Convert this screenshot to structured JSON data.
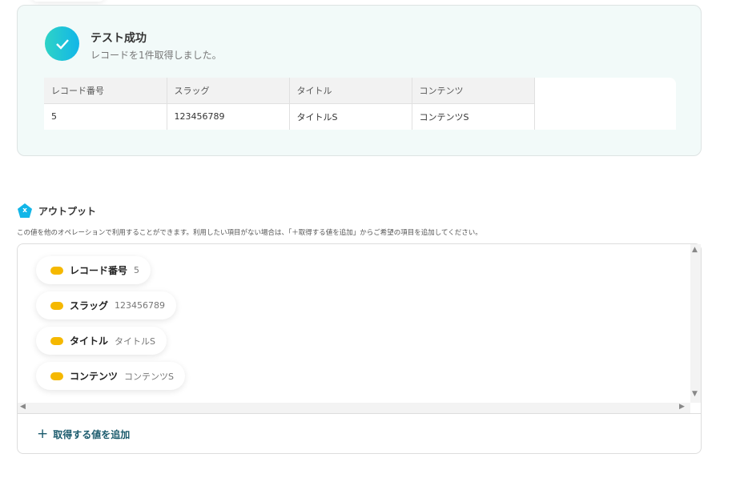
{
  "result": {
    "title": "テスト成功",
    "subtitle": "レコードを1件取得しました。",
    "columns": [
      "レコード番号",
      "スラッグ",
      "タイトル",
      "コンテンツ"
    ],
    "row": [
      "5",
      "123456789",
      "タイトルS",
      "コンテンツS"
    ]
  },
  "output": {
    "title": "アウトプット",
    "icon_letter": "x",
    "description": "この値を他のオペレーションで利用することができます。利用したい項目がない場合は、「＋取得する値を追加」からご希望の項目を追加してください。",
    "items": [
      {
        "label": "レコード番号",
        "value": "5"
      },
      {
        "label": "スラッグ",
        "value": "123456789"
      },
      {
        "label": "タイトル",
        "value": "タイトルS"
      },
      {
        "label": "コンテンツ",
        "value": "コンテンツS"
      }
    ],
    "add_label": "取得する値を追加"
  },
  "colors": {
    "accent": "#12b6e8",
    "success_bg": "#f2faf9",
    "chip_icon": "#f5b800",
    "link": "#1a5a6c"
  }
}
